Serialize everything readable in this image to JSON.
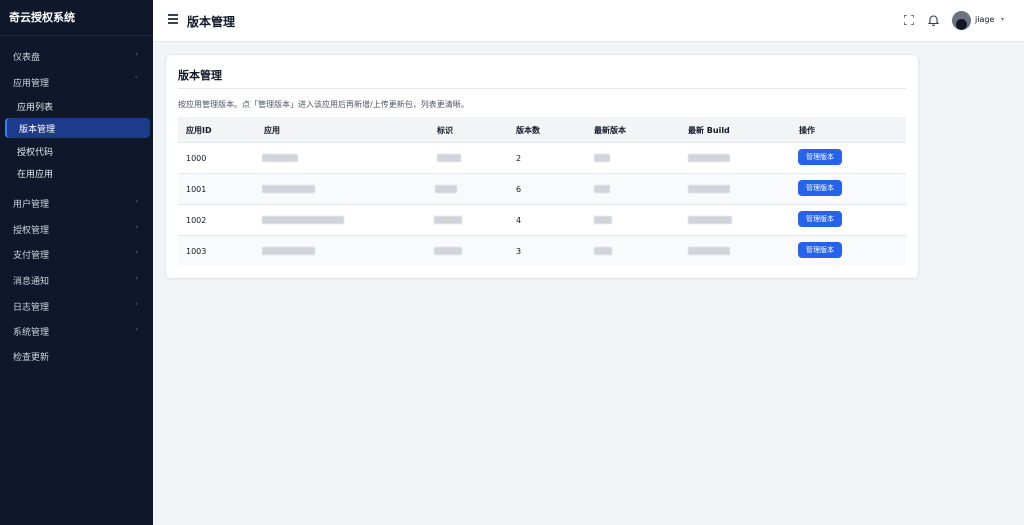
{
  "app": {
    "brand": "奇云授权系统"
  },
  "sidebar": {
    "menus": [
      {
        "label": "仪表盘",
        "caret": "›"
      },
      {
        "label": "应用管理",
        "caret": "˅"
      },
      {
        "label": "用户管理",
        "caret": "›"
      },
      {
        "label": "授权管理",
        "caret": "›"
      },
      {
        "label": "支付管理",
        "caret": "›"
      },
      {
        "label": "消息通知",
        "caret": "›"
      },
      {
        "label": "日志管理",
        "caret": "›"
      },
      {
        "label": "系统管理",
        "caret": "›"
      },
      {
        "label": "检查更新"
      }
    ],
    "submenu": [
      {
        "label": "应用列表"
      },
      {
        "label": "版本管理",
        "active": true
      },
      {
        "label": "授权代码"
      },
      {
        "label": "在用应用"
      }
    ]
  },
  "topbar": {
    "title": "版本管理",
    "username": "jiage",
    "user_caret": "▾"
  },
  "card": {
    "title": "版本管理",
    "description": "按应用管理版本。点「管理版本」进入该应用后再新增/上传更新包，列表更清晰。"
  },
  "table": {
    "headers": [
      "应用ID",
      "应用",
      "标识",
      "版本数",
      "最新版本",
      "最新 Build",
      "操作"
    ],
    "rows": [
      {
        "id": "1000",
        "count": "2",
        "action": "管理版本"
      },
      {
        "id": "1001",
        "count": "6",
        "action": "管理版本"
      },
      {
        "id": "1002",
        "count": "4",
        "action": "管理版本"
      },
      {
        "id": "1003",
        "count": "3",
        "action": "管理版本"
      }
    ]
  },
  "colors": {
    "sidebar_bg": "#0f172a",
    "accent": "#2563eb",
    "active_item": "#1e3a8a"
  }
}
